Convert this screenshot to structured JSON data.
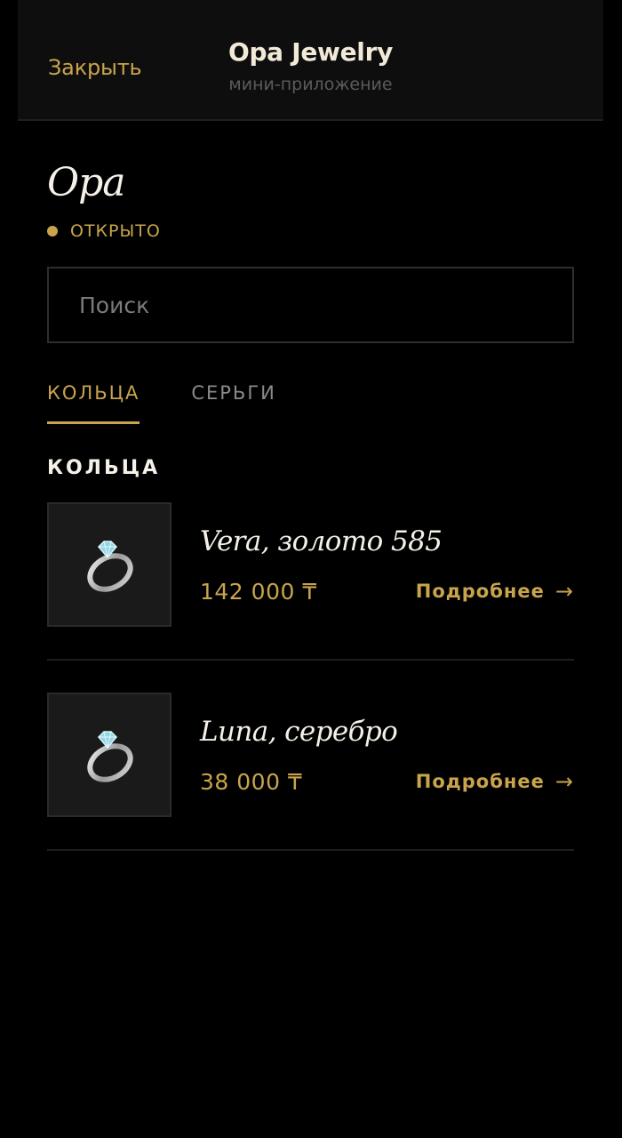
{
  "header": {
    "close_label": "Закрыть",
    "title": "Opa Jewelry",
    "subtitle": "мини-приложение"
  },
  "store": {
    "name": "Opa",
    "status": "ОТКРЫТО"
  },
  "search": {
    "placeholder": "Поиск",
    "value": ""
  },
  "tabs": [
    {
      "label": "КОЛЬЦА",
      "active": true
    },
    {
      "label": "СЕРЬГИ",
      "active": false
    }
  ],
  "section": {
    "title": "КОЛЬЦА"
  },
  "products": [
    {
      "name": "Vera, золото 585",
      "price": "142 000 ₸",
      "icon": "ring-icon",
      "link_label": "Подробнее",
      "arrow": "→"
    },
    {
      "name": "Luna, серебро",
      "price": "38 000 ₸",
      "icon": "ring-icon",
      "link_label": "Подробнее",
      "arrow": "→"
    }
  ],
  "colors": {
    "accent": "#c9a44c",
    "background": "#000000",
    "topbar": "#0e0e0e",
    "thumb_bg": "#1a1a1a"
  }
}
